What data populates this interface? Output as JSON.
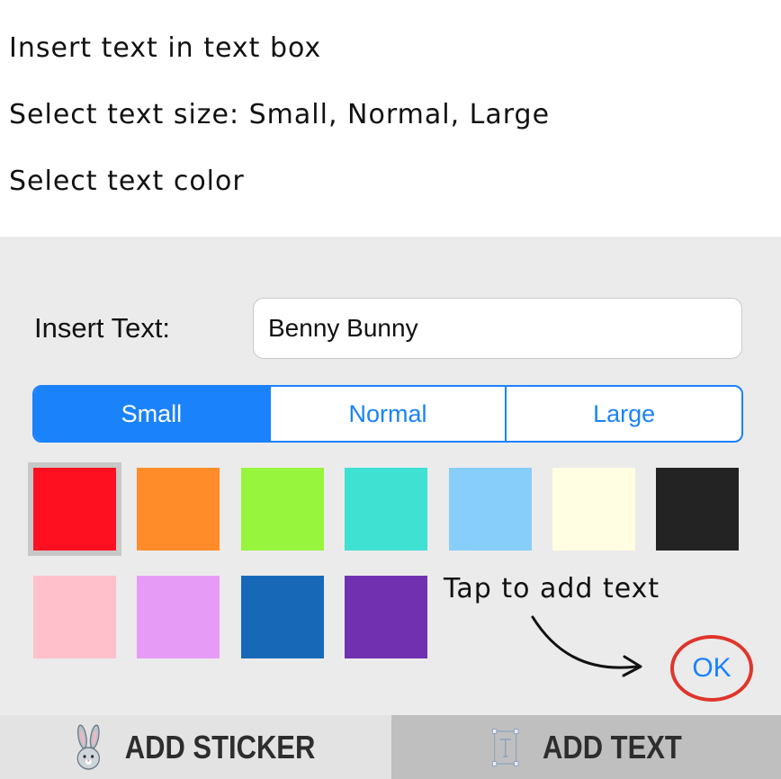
{
  "instructions": [
    "Insert text in text box",
    "Select text size: Small, Normal, Large",
    "Select text color"
  ],
  "panel": {
    "insert_label": "Insert Text:",
    "text_value": "Benny Bunny",
    "size_options": [
      "Small",
      "Normal",
      "Large"
    ],
    "selected_size": "Small",
    "colors": [
      "#ff1020",
      "#ff8c28",
      "#96f53c",
      "#3ee1d2",
      "#87cefa",
      "#fffde2",
      "#232323",
      "#ffc0cb",
      "#e69cf6",
      "#1769b8",
      "#7030b0"
    ],
    "selected_color": "#ff1020",
    "hint": "Tap to add text",
    "ok_label": "OK",
    "accent": "#1a82fb",
    "highlight_color": "#e0352b"
  },
  "bottom_bar": {
    "sticker_label": "ADD STICKER",
    "sticker_icon": "bunny-icon",
    "text_label": "ADD TEXT",
    "text_icon": "text-frame-icon"
  }
}
